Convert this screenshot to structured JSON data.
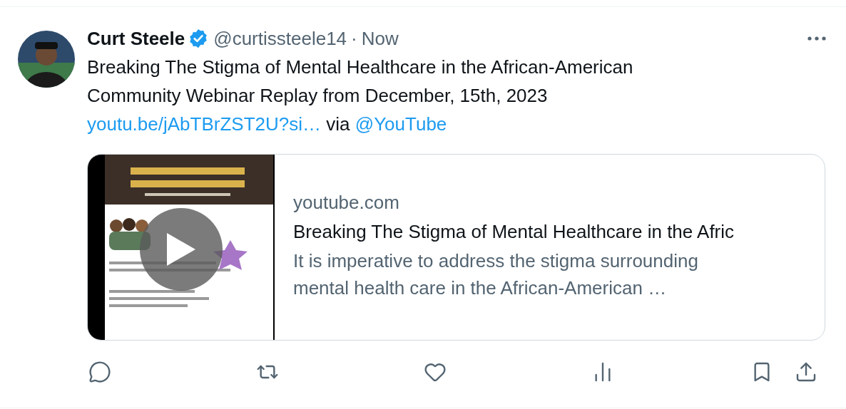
{
  "post": {
    "author": {
      "name": "Curt Steele",
      "verified": true,
      "handle": "@curtissteele14",
      "separator": "·",
      "time": "Now"
    },
    "body": {
      "text": "Breaking The Stigma of Mental Healthcare in the African-American Community Webinar Replay from December, 15th, 2023",
      "link": "youtu.be/jAbTBrZST2U?si…",
      "via": "via",
      "mention": "@YouTube"
    },
    "card": {
      "domain": "youtube.com",
      "title": "Breaking The Stigma of Mental Healthcare in the Afric",
      "description": "It is imperative to address the stigma surrounding mental health care in the African-American …"
    }
  }
}
